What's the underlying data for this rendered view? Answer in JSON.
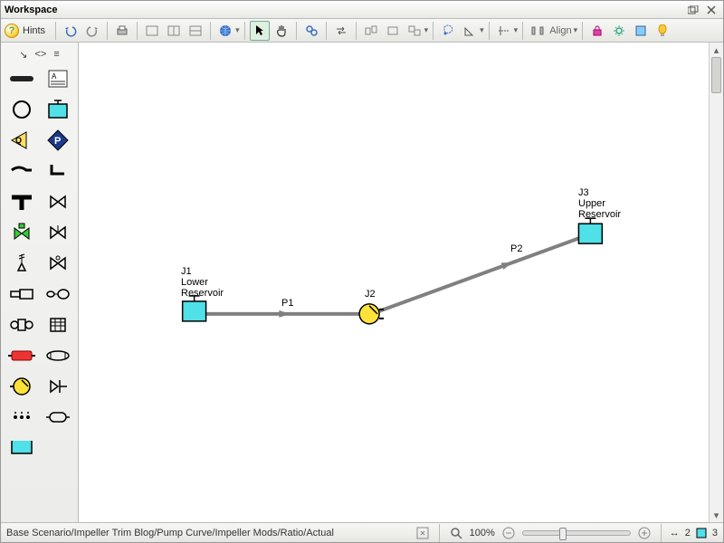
{
  "window": {
    "title": "Workspace"
  },
  "toolbar": {
    "hints_label": "Hints",
    "align_label": "Align"
  },
  "palette": {
    "tabs": [
      "↘",
      "<>",
      "≡"
    ]
  },
  "diagram": {
    "j1": {
      "id": "J1",
      "name": "Lower\nReservoir"
    },
    "j2": {
      "id": "J2"
    },
    "j3": {
      "id": "J3",
      "name": "Upper\nReservoir"
    },
    "p1": "P1",
    "p2": "P2"
  },
  "status": {
    "scenario_path": "Base Scenario/Impeller Trim Blog/Pump Curve/Impeller Mods/Ratio/Actual",
    "zoom_label": "100%",
    "pipe_count": "2",
    "junction_count": "3"
  },
  "colors": {
    "reservoir": "#4fe0e8",
    "pump": "#ffe23a",
    "pipe": "#808080"
  }
}
